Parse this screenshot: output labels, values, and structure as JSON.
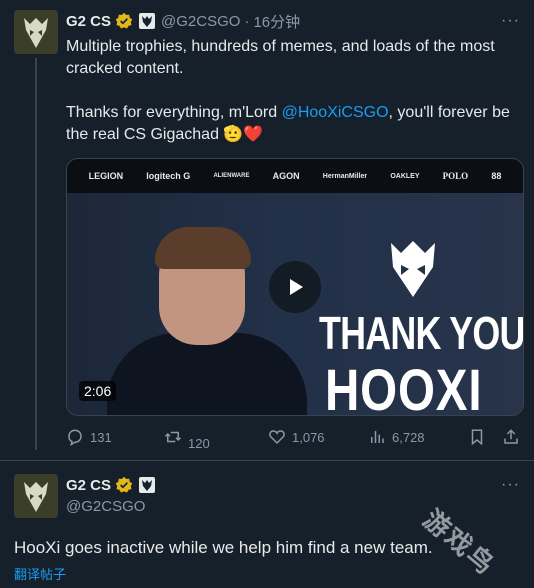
{
  "tweet": {
    "author_name": "G2 CS",
    "handle": "@G2CSGO",
    "separator": "·",
    "time": "16分钟",
    "lines": [
      "Multiple trophies, hundreds of memes, and loads of the most cracked content."
    ],
    "line2_prefix": "Thanks for everything, m'Lord ",
    "line2_mention": "@HooXiCSGO",
    "line2_suffix": ", you'll forever be the real CS Gigachad 🫡❤️",
    "media": {
      "sponsors": [
        "LEGION",
        "logitech G",
        "ALIENWARE",
        "AGON",
        "HermanMiller",
        "OAKLEY",
        "POLO",
        "88"
      ],
      "headline_1": "THANK YOU",
      "headline_2": "HOOXI",
      "duration": "2:06"
    },
    "stats": {
      "replies": "131",
      "retweets": "120",
      "likes": "1,076",
      "views": "6,728"
    }
  },
  "tweet2": {
    "author_name": "G2 CS",
    "handle": "@G2CSGO",
    "text": "HooXi goes inactive while we help him find a new team.",
    "translate": "翻译帖子"
  },
  "watermark": "游戏鸟",
  "colors": {
    "background": "#15202b",
    "accent": "#1d9bf0",
    "verified": "#e2b719",
    "heart": "#f91880"
  }
}
